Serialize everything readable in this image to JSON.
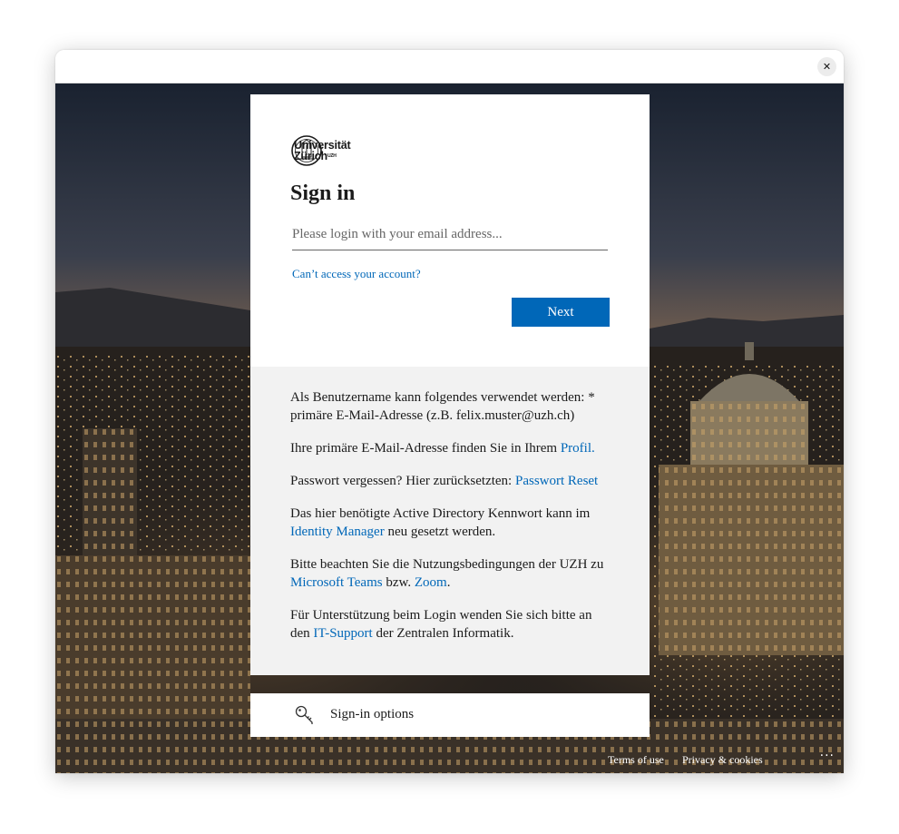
{
  "window": {
    "close_glyph": "✕"
  },
  "login": {
    "logo": {
      "line1": "Universität",
      "line2": "Zürich",
      "superscript": "UZH"
    },
    "title": "Sign in",
    "email_placeholder": "Please login with your email address...",
    "cant_access": "Can’t access your account?",
    "next_label": "Next"
  },
  "info": {
    "p1": "Als Benutzername kann folgendes verwendet werden: * primäre E-Mail-Adresse (z.B. felix.muster@uzh.ch)",
    "p2_text": "Ihre primäre E-Mail-Adresse finden Sie in Ihrem ",
    "p2_link": "Profil",
    "p2_end": ".",
    "p3_text": "Passwort vergessen? Hier zurücksetzten: ",
    "p3_link": "Passwort Reset",
    "p4_text": "Das hier benötigte Active Directory Kennwort kann im ",
    "p4_link": "Identity Manager",
    "p4_end": " neu gesetzt werden.",
    "p5_text": "Bitte beachten Sie die Nutzungsbedingungen der UZH zu ",
    "p5_link1": "Microsoft Teams",
    "p5_mid": " bzw. ",
    "p5_link2": "Zoom",
    "p5_end": ".",
    "p6_text": "Für Unterstützung beim Login wenden Sie sich bitte an den ",
    "p6_link": "IT-Support",
    "p6_end": " der Zentralen Informatik."
  },
  "signin_options": {
    "label": "Sign-in options",
    "icon": "key-icon"
  },
  "footer": {
    "terms": "Terms of use",
    "privacy": "Privacy & cookies",
    "more": "···"
  },
  "colors": {
    "accent": "#0067b8",
    "info_bg": "#f2f2f2"
  }
}
